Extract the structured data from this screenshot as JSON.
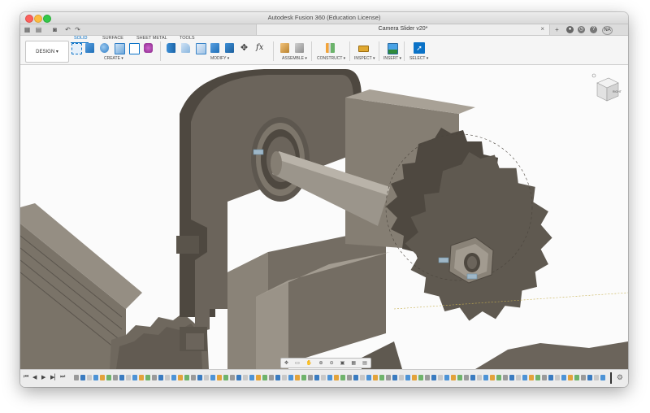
{
  "window": {
    "title": "Autodesk Fusion 360 (Education License)"
  },
  "tabbar": {
    "document_tab": "Camera Slider v20*",
    "user_initials": "NA"
  },
  "toolbar": {
    "workspace": "DESIGN ▾",
    "mode_tabs": [
      "SOLID",
      "SURFACE",
      "SHEET METAL",
      "TOOLS"
    ],
    "active_tab": "SOLID",
    "groups": [
      "CREATE ▾",
      "MODIFY ▾",
      "ASSEMBLE ▾",
      "CONSTRUCT ▾",
      "INSPECT ▾",
      "INSERT ▾",
      "SELECT ▾"
    ],
    "modify_fx": "fx"
  },
  "viewcube": {
    "face_label": "RIGHT"
  },
  "colors": {
    "accent": "#0a72c7",
    "part_fill": "#6b645b",
    "part_dark": "#4e4840",
    "part_light": "#8a8378"
  }
}
